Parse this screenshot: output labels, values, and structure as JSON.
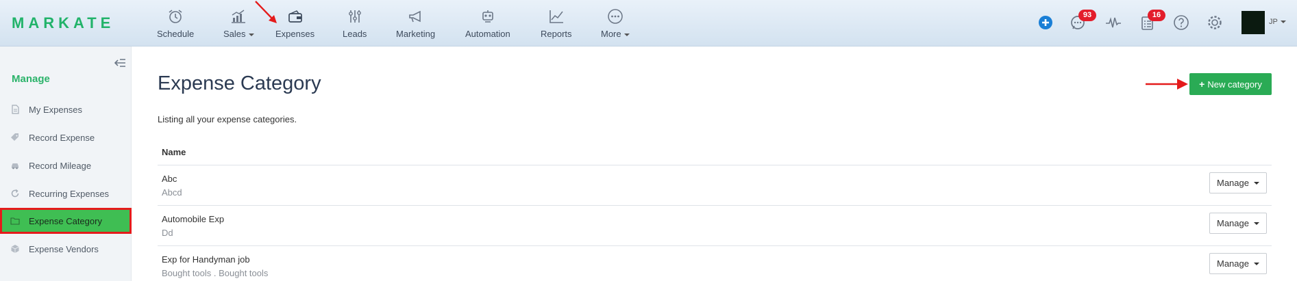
{
  "brand": {
    "logo": "MARKATE"
  },
  "nav": [
    {
      "label": "Schedule",
      "icon": "alarm-clock-icon"
    },
    {
      "label": "Sales",
      "icon": "sales-chart-icon",
      "dropdown": true
    },
    {
      "label": "Expenses",
      "icon": "wallet-icon"
    },
    {
      "label": "Leads",
      "icon": "sliders-icon"
    },
    {
      "label": "Marketing",
      "icon": "megaphone-icon"
    },
    {
      "label": "Automation",
      "icon": "robot-icon"
    },
    {
      "label": "Reports",
      "icon": "line-chart-icon"
    },
    {
      "label": "More",
      "icon": "more-dots-icon",
      "dropdown": true
    }
  ],
  "header": {
    "messages_badge": "93",
    "tasks_badge": "16",
    "user_initials": "JP"
  },
  "sidebar": {
    "heading": "Manage",
    "items": [
      {
        "label": "My Expenses",
        "icon": "document-icon"
      },
      {
        "label": "Record Expense",
        "icon": "tag-icon"
      },
      {
        "label": "Record Mileage",
        "icon": "car-icon"
      },
      {
        "label": "Recurring Expenses",
        "icon": "refresh-icon"
      },
      {
        "label": "Expense Category",
        "icon": "folder-icon",
        "active": true
      },
      {
        "label": "Expense Vendors",
        "icon": "cube-icon"
      }
    ]
  },
  "main": {
    "title": "Expense Category",
    "new_button": "New category",
    "subtitle": "Listing all your expense categories.",
    "column_name": "Name",
    "manage_label": "Manage",
    "rows": [
      {
        "name": "Abc",
        "description": "Abcd"
      },
      {
        "name": "Automobile Exp",
        "description": "Dd"
      },
      {
        "name": "Exp for Handyman job",
        "description": "Bought tools . Bought tools"
      }
    ]
  },
  "colors": {
    "brand_green": "#22b36a",
    "button_green": "#2aab55",
    "active_green": "#3fbe53",
    "highlight_red": "#e41b1b",
    "badge_red": "#e31d2b"
  }
}
